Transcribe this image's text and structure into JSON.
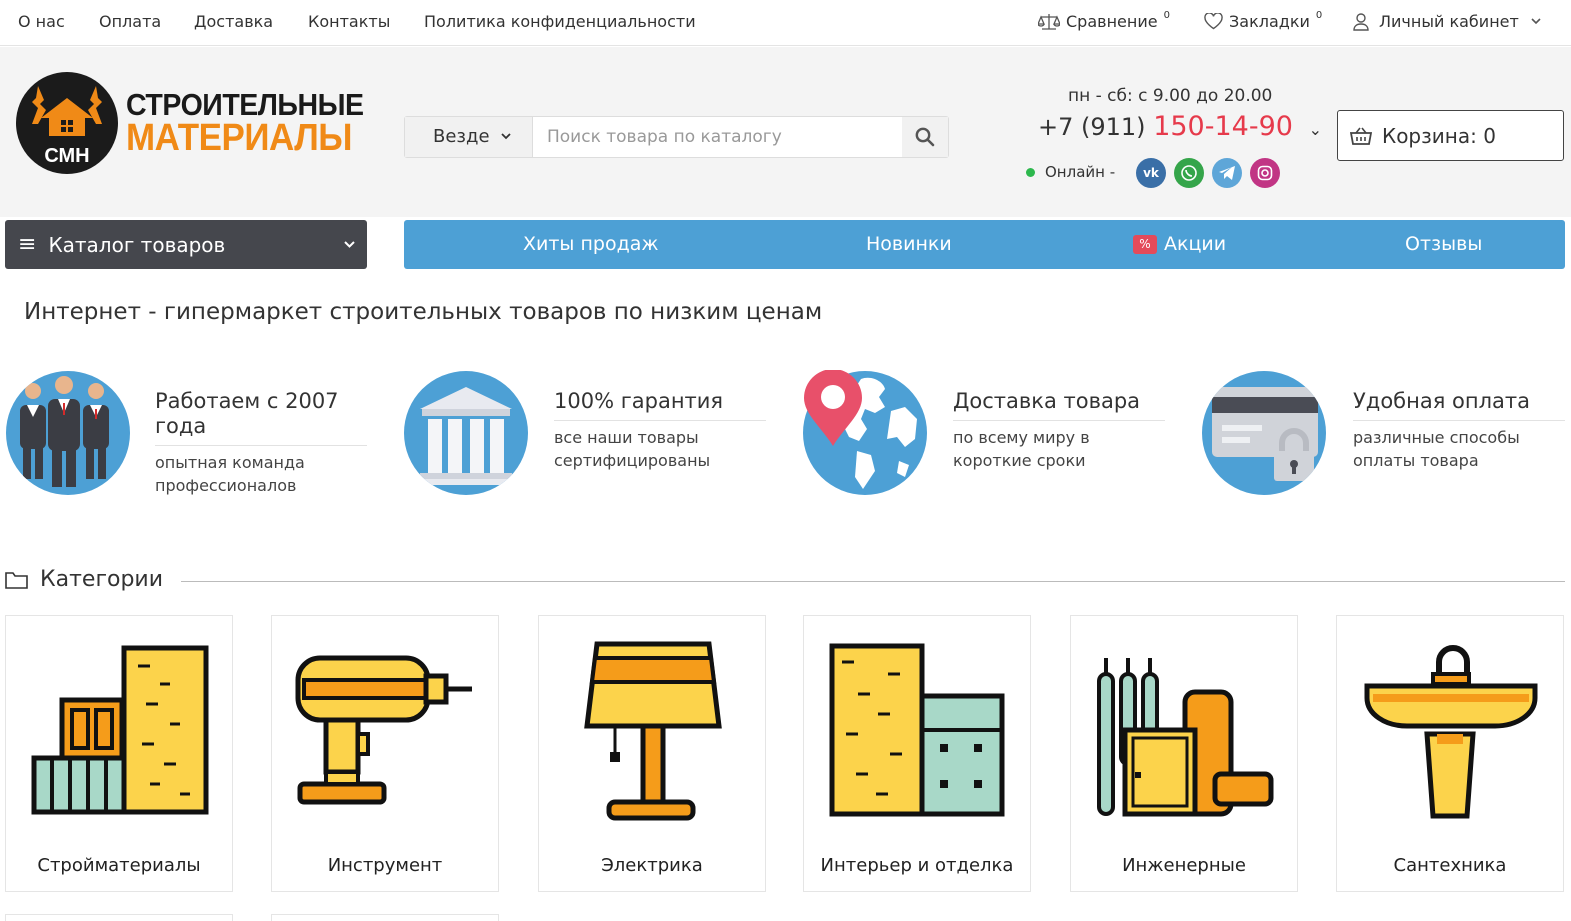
{
  "topbar": {
    "links": [
      "О нас",
      "Оплата",
      "Доставка",
      "Контакты",
      "Политика конфиденциальности"
    ],
    "compare_label": "Сравнение",
    "compare_count": "0",
    "bookmarks_label": "Закладки",
    "bookmarks_count": "0",
    "account_label": "Личный кабинет"
  },
  "logo": {
    "monogram": "СМН",
    "line1": "СТРОИТЕЛЬНЫЕ",
    "line2": "МАТЕРИАЛЫ"
  },
  "search": {
    "scope": "Везде",
    "placeholder": "Поиск товара по каталогу"
  },
  "contacts": {
    "hours": "пн - сб: с 9.00 до 20.00",
    "phone_prefix": "+7 (911)",
    "phone_main": "150-14-90",
    "online_label": "Онлайн -",
    "social": [
      "vk-icon",
      "whatsapp-icon",
      "telegram-icon",
      "instagram-icon"
    ]
  },
  "cart": {
    "label": "Корзина: 0"
  },
  "nav": {
    "catalog_label": "Каталог товаров",
    "items": [
      "Хиты продаж",
      "Новинки",
      "Акции",
      "Отзывы"
    ],
    "promo_badge": "%"
  },
  "tagline": "Интернет - гипермаркет строительных товаров по низким ценам",
  "features": [
    {
      "title": "Работаем с 2007 года",
      "desc": "опытная команда профессионалов"
    },
    {
      "title": "100% гарантия",
      "desc": "все наши товары сертифицированы"
    },
    {
      "title": "Доставка товара",
      "desc": "по всему миру в короткие сроки"
    },
    {
      "title": "Удобная оплата",
      "desc": "различные способы оплаты товара"
    }
  ],
  "categories": {
    "heading": "Категории",
    "items": [
      "Стройматериалы",
      "Инструмент",
      "Электрика",
      "Интерьер и отделка",
      "Инженерные",
      "Сантехника"
    ]
  },
  "colors": {
    "accent_blue": "#4da0d5",
    "brand_orange": "#f08a17",
    "phone_red": "#e63a4b",
    "dark_button": "#45474d",
    "icon_yellow": "#fcd34b",
    "icon_orange": "#f59c1a",
    "icon_mint": "#a8d8c8"
  }
}
